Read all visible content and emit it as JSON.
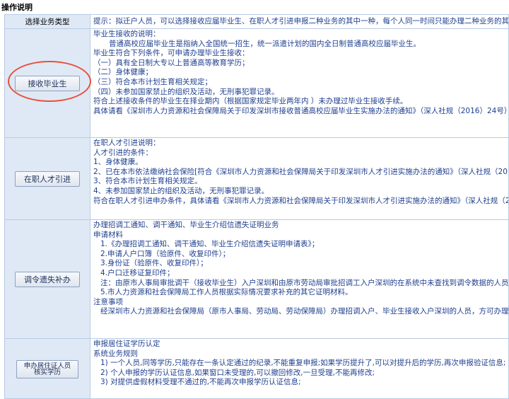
{
  "page_title": "操作说明",
  "header": {
    "label": "选择业务类型",
    "tip": "提示：拟迁户人员，可以选择接收应届毕业生、在职人才引进申报二种业务的其中一种，每个人同一时间只能办理二种业务的其中一"
  },
  "sections": [
    {
      "button": "接收毕业生",
      "lines": [
        "毕业生接收的说明：",
        "普通高校应届毕业生是指纳入全国统一招生，统一派遣计划的国内全日制普通高校应届毕业生。",
        "毕业生符合下列条件，可申请办理毕业生接收：",
        "（一）具有全日制大专以上普通高等教育学历；",
        "（二）身体健康；",
        "（三）符合本市计划生育相关规定；",
        "（四）未参加国家禁止的组织及活动，无刑事犯罪记录。",
        "符合上述接收条件的毕业生在择业期内（根据国家规定毕业两年内 ）未办理过毕业生接收手续。",
        "具体请看《深圳市人力资源和社会保障局关于印发深圳市接收普通高校应届毕业生实施办法的通知》（深人社规（2016）24号）"
      ]
    },
    {
      "button": "在职人才引进",
      "lines": [
        "在职人才引进说明：",
        "人才引进的条件：",
        "1、身体健康。",
        "2、已在本市依法缴纳社会保险[符合《深圳市人力资源和社会保障局关于印发深圳市人才引进实施办法的通知》（深人社规（2016",
        "3、符合本市计划生育相关规定。",
        "4、未参加国家禁止的组织及活动，无刑事犯罪记录。",
        "符合在职人才引进申办条件，具体请看《深圳市人力资源和社会保障局关于印发深圳市人才引进实施办法的通知》（深人社规（20"
      ]
    },
    {
      "button": "调令遗失补办",
      "lines": [
        "办理招调工通知、调干通知、毕业生介绍信遗失证明业务",
        "申请材料",
        "1.《办理招调工通知、调干通知、毕业生介绍信遗失证明申请表》；",
        "2.申请人户口簿（验原件、收复印件）；",
        "3.身份证（验原件、收复印件）；",
        "4.户口迁移证复印件；",
        "注：由原市人事局审批调干（接收毕业生）入户深圳和由原市劳动局审批招调工入户深圳的在系统中未查找到调令数据的人员，需",
        "5.市人力资源和社会保障局工作人员根据实际情况要求补充的其它证明材料。",
        "注意事项",
        "经深圳市人力资源和社会保障局（原市人事局、劳动局、劳动保障局）办理招调入户、毕业生接收入户深圳的人员，方可办理此项"
      ]
    },
    {
      "button": "申办居住证人员核实学历",
      "lines": [
        "申报居住证学历认定",
        "系统业务规则",
        "1) 一个人员,同等学历,只能存在一条认定通过的纪录,不能重复申报;如果学历提升了,可以对提升后的学历,再次申报验证信息;",
        "2) 个人申报的学历认证信息,如果窗口未受理的,可以撤回修改,一旦受理,不能再修改;",
        "3) 对提供虚假材料受理不通过的,不能再次申报学历认证信息;"
      ]
    }
  ]
}
